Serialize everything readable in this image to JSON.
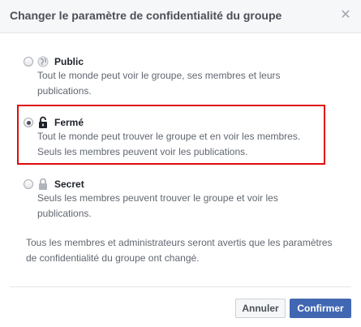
{
  "dialog": {
    "title": "Changer le paramètre de confidentialité du groupe",
    "close_icon": "close-icon"
  },
  "options": [
    {
      "label": "Public",
      "icon": "globe-icon",
      "description": "Tout le monde peut voir le groupe, ses membres et leurs publications.",
      "selected": false
    },
    {
      "label": "Fermé",
      "icon": "unlocked-padlock-icon",
      "description": "Tout le monde peut trouver le groupe et en voir les membres. Seuls les membres peuvent voir les publications.",
      "selected": true
    },
    {
      "label": "Secret",
      "icon": "padlock-icon",
      "description": "Seuls les membres peuvent trouver le groupe et voir les publications.",
      "selected": false
    }
  ],
  "note": "Tous les membres et administrateurs seront avertis que les paramètres de confidentialité du groupe ont changé.",
  "buttons": {
    "cancel": "Annuler",
    "confirm": "Confirmer"
  },
  "colors": {
    "primary": "#4267b2",
    "highlight": "#e00b0b",
    "header_bg": "#f6f7f9"
  }
}
